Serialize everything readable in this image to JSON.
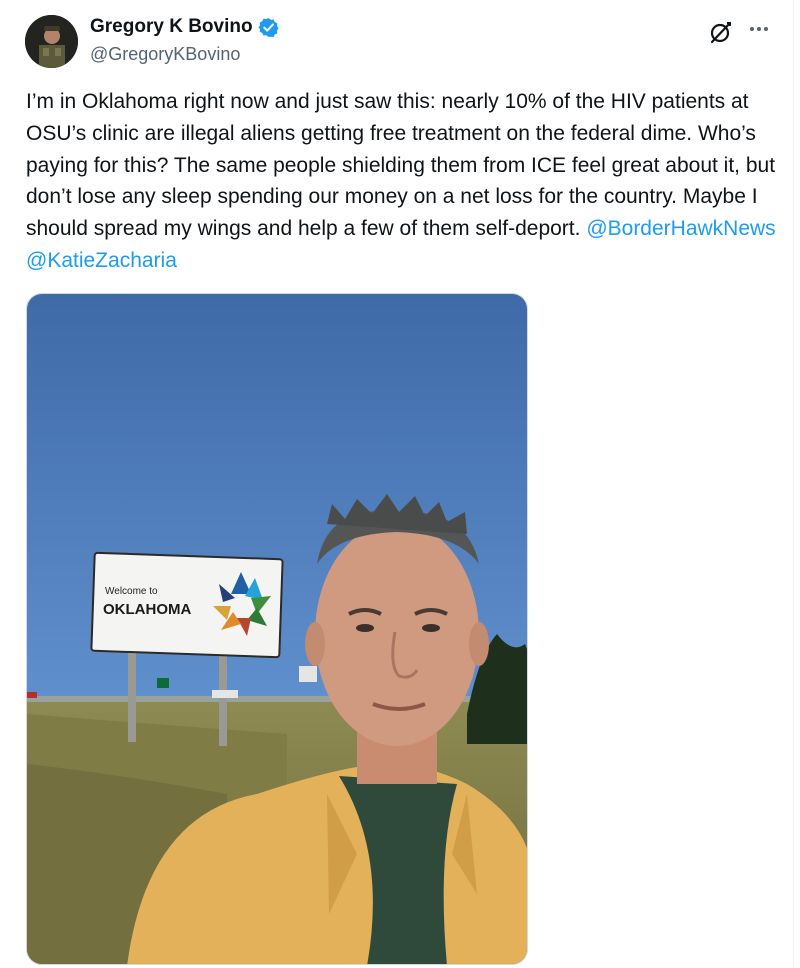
{
  "author": {
    "display_name": "Gregory K Bovino",
    "handle": "@GregoryKBovino",
    "verified": true,
    "verified_color": "#1d9bf0"
  },
  "icons": {
    "verified": "verified-badge-icon",
    "grok": "grok-icon",
    "more": "more-options-icon"
  },
  "tweet": {
    "text": "I’m in Oklahoma right now and just saw this: nearly 10% of the HIV patients at OSU’s clinic are illegal aliens getting free treatment on the federal dime. Who’s paying for this? The same people shielding them from ICE feel great about it, but don’t lose any sleep spending our money on a net loss for the country. Maybe I should spread my wings and help a few of them self-deport. ",
    "mentions": [
      "@BorderHawkNews",
      "@KatieZacharia"
    ],
    "mention_color": "#1d9bf0"
  },
  "media": {
    "sign_line1": "Welcome to",
    "sign_line2": "OKLAHOMA"
  }
}
